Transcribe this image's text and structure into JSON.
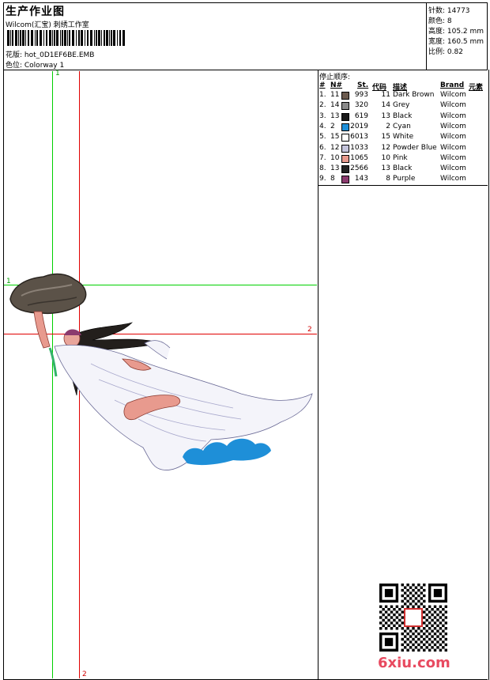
{
  "header": {
    "title": "生产作业图",
    "company": "Wilcom(汇宝) 刺绣工作室",
    "design_label": "花版: hot_0D1EF6BE.EMB",
    "colorway_label": "色位: Colorway 1"
  },
  "stats": [
    "针数: 14773",
    "颜色: 8",
    "高度: 105.2 mm",
    "宽度: 160.5 mm",
    "比例: 0.82"
  ],
  "sequence": {
    "title": "停止顺序:",
    "columns": [
      "#",
      "N#",
      "St.",
      "代码",
      "描述",
      "Brand",
      "元素"
    ],
    "rows": [
      {
        "idx": "1.",
        "n": "11",
        "st": "993",
        "code": "11",
        "desc": "Dark Brown",
        "brand": "Wilcom",
        "color": "#6b5a4e"
      },
      {
        "idx": "2.",
        "n": "14",
        "st": "320",
        "code": "14",
        "desc": "Grey",
        "brand": "Wilcom",
        "color": "#8a8a8a"
      },
      {
        "idx": "3.",
        "n": "13",
        "st": "619",
        "code": "13",
        "desc": "Black",
        "brand": "Wilcom",
        "color": "#1a1a1a"
      },
      {
        "idx": "4.",
        "n": "2",
        "st": "2019",
        "code": "2",
        "desc": "Cyan",
        "brand": "Wilcom",
        "color": "#1e8fd8"
      },
      {
        "idx": "5.",
        "n": "15",
        "st": "6013",
        "code": "15",
        "desc": "White",
        "brand": "Wilcom",
        "color": "#ffffff"
      },
      {
        "idx": "6.",
        "n": "12",
        "st": "1033",
        "code": "12",
        "desc": "Powder Blue",
        "brand": "Wilcom",
        "color": "#c4c4dc"
      },
      {
        "idx": "7.",
        "n": "10",
        "st": "1065",
        "code": "10",
        "desc": "Pink",
        "brand": "Wilcom",
        "color": "#e89a8e"
      },
      {
        "idx": "8.",
        "n": "13",
        "st": "2566",
        "code": "13",
        "desc": "Black",
        "brand": "Wilcom",
        "color": "#222222"
      },
      {
        "idx": "9.",
        "n": "8",
        "st": "143",
        "code": "8",
        "desc": "Purple",
        "brand": "Wilcom",
        "color": "#8b3a6e"
      }
    ]
  },
  "guides": {
    "green_v": "1",
    "green_h": "1",
    "red_v": "2",
    "red_h": "2"
  },
  "watermark": {
    "site": "6xiu.com"
  }
}
